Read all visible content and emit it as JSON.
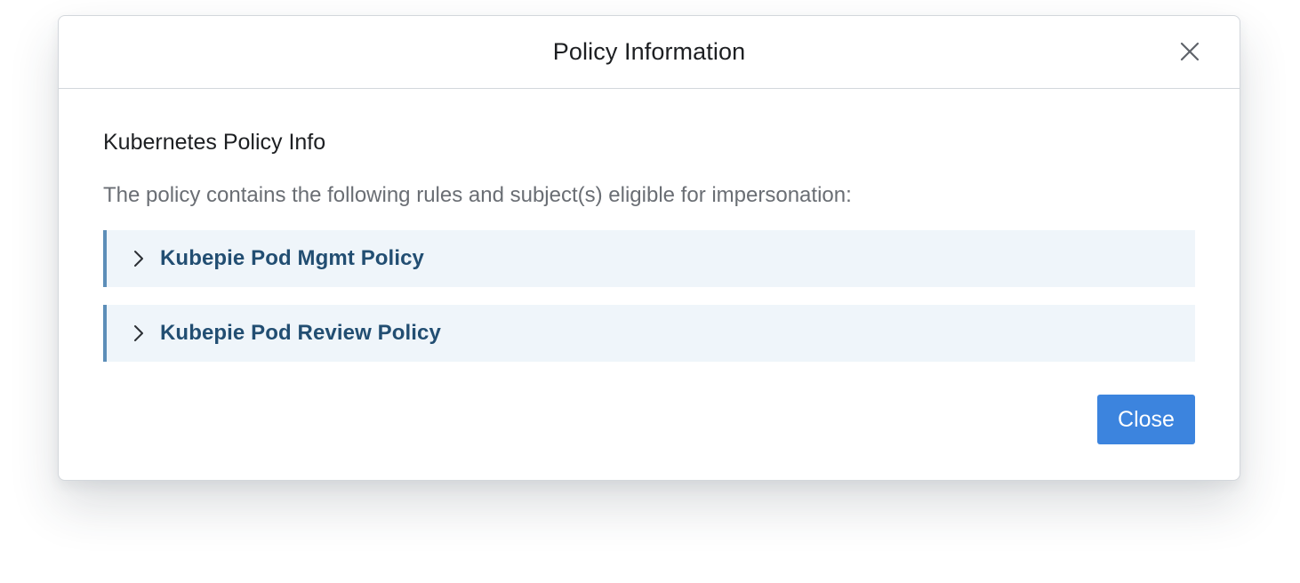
{
  "modal": {
    "title": "Policy Information",
    "close_icon": "close-icon"
  },
  "body": {
    "section_title": "Kubernetes Policy Info",
    "description": "The policy contains the following rules and subject(s) eligible for impersonation:",
    "policies": [
      {
        "label": "Kubepie Pod Mgmt Policy",
        "icon": "chevron-right-icon",
        "expanded": false
      },
      {
        "label": "Kubepie Pod Review Policy",
        "icon": "chevron-right-icon",
        "expanded": false
      }
    ]
  },
  "footer": {
    "close_label": "Close"
  },
  "colors": {
    "accent": "#3c84de",
    "policy_bg": "#eff5fa",
    "policy_border": "#5c8eb8",
    "policy_text": "#224e72",
    "muted_text": "#6a6e74"
  }
}
